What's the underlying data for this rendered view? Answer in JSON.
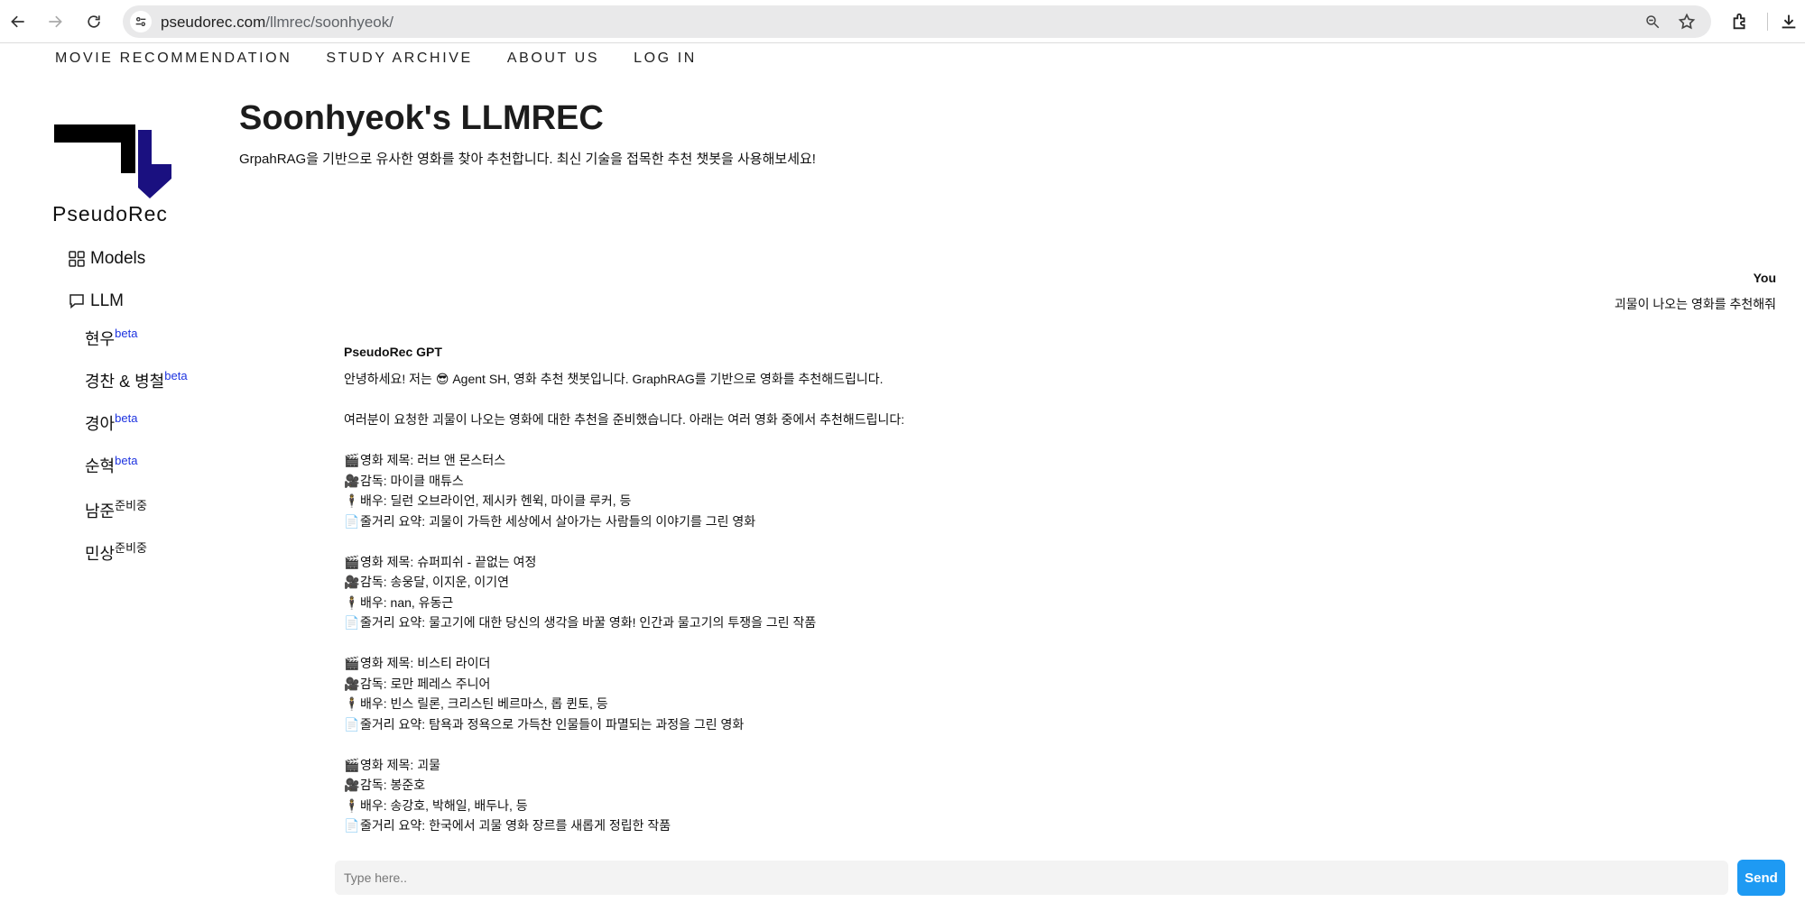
{
  "browser": {
    "url_domain": "pseudorec.com",
    "url_path": "/llmrec/soonhyeok/"
  },
  "topnav": {
    "items": [
      {
        "label": "MOVIE RECOMMENDATION"
      },
      {
        "label": "STUDY ARCHIVE"
      },
      {
        "label": "ABOUT US"
      },
      {
        "label": "LOG IN"
      }
    ]
  },
  "sidebar": {
    "brand": "PseudoRec",
    "models_label": "Models",
    "llm_label": "LLM",
    "sub_items": [
      {
        "label": "현우",
        "tag": "beta"
      },
      {
        "label": "경찬 & 병철",
        "tag": "beta"
      },
      {
        "label": "경아",
        "tag": "beta"
      },
      {
        "label": "순혁",
        "tag": "beta"
      },
      {
        "label": "남준",
        "tag": "준비중"
      },
      {
        "label": "민상",
        "tag": "준비중"
      }
    ],
    "logo_colors": {
      "black": "#000000",
      "navy": "#1a1080"
    }
  },
  "header": {
    "title": "Soonhyeok's LLMREC",
    "description": "GrpahRAG을 기반으로 유사한 영화를 찾아 추천합니다. 최신 기술을 접목한 추천 챗봇을 사용해보세요!"
  },
  "chat": {
    "user_name": "You",
    "user_message": "괴물이 나오는 영화를 추천해줘",
    "bot_name": "PseudoRec GPT",
    "bot_intro_before_emoji": "안녕하세요! 저는 ",
    "bot_intro_emoji": "😎",
    "bot_intro_after_emoji": " Agent SH, 영화 추천 챗봇입니다. GraphRAG를 기반으로 영화를 추천해드립니다.",
    "bot_lead": "여러분이 요청한 괴물이 나오는 영화에 대한 추천을 준비했습니다. 아래는 여러 영화 중에서 추천해드립니다:",
    "movies": [
      {
        "title": "영화 제목: 러브 앤 몬스터스",
        "director": "감독: 마이클 매튜스",
        "cast": "배우: 딜런 오브라이언, 제시카 헨윅, 마이클 루커, 등",
        "summary": "줄거리 요약: 괴물이 가득한 세상에서 살아가는 사람들의 이야기를 그린 영화"
      },
      {
        "title": "영화 제목: 슈퍼피쉬 - 끝없는 여정",
        "director": "감독: 송웅달, 이지운, 이기연",
        "cast": "배우: nan, 유동근",
        "summary": "줄거리 요약: 물고기에 대한 당신의 생각을 바꿀 영화! 인간과 물고기의 투쟁을 그린 작품"
      },
      {
        "title": "영화 제목: 비스티 라이더",
        "director": "감독: 로만 페레스 주니어",
        "cast": "배우: 빈스 릴론, 크리스틴 베르마스, 롭 퀸토, 등",
        "summary": "줄거리 요약: 탐욕과 정욕으로 가득찬 인물들이 파멸되는 과정을 그린 영화"
      },
      {
        "title": "영화 제목: 괴물",
        "director": "감독: 봉준호",
        "cast": "배우: 송강호, 박해일, 배두나, 등",
        "summary": "줄거리 요약: 한국에서 괴물 영화 장르를 새롭게 정립한 작품"
      }
    ],
    "input_placeholder": "Type here..",
    "send_label": "Send"
  }
}
